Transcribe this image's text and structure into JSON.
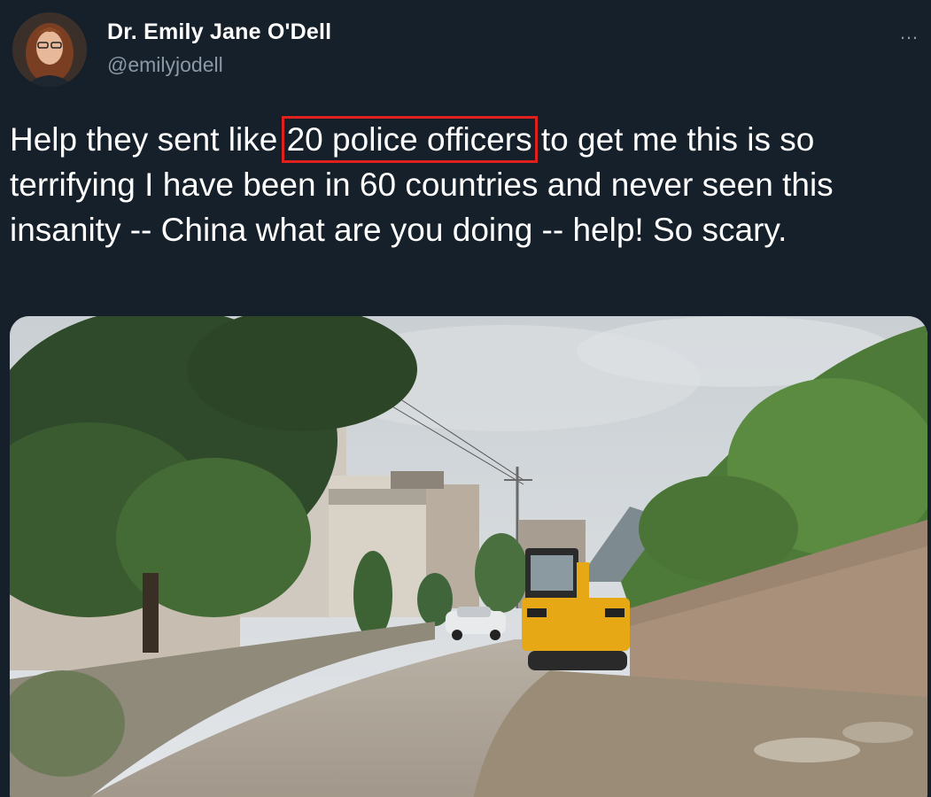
{
  "author": {
    "name": "Dr. Emily Jane O'Dell",
    "handle": "@emilyjodell",
    "avatar_icon": "profile-photo"
  },
  "menu": {
    "more_label": "…",
    "icon": "more-horizontal-icon"
  },
  "tweet": {
    "text_before": "Help they sent like ",
    "highlight": "20 police officers",
    "text_after": " to get me this is so terrifying I have been in 60 countries and never seen this insanity -- China what are you doing -- help! So scary.",
    "highlight_color": "#e0201c"
  },
  "media": {
    "type": "photo",
    "subject": "village road with yellow excavator"
  },
  "colors": {
    "background": "#15202b",
    "secondary_text": "#8b98a5",
    "primary_text": "#ffffff"
  }
}
